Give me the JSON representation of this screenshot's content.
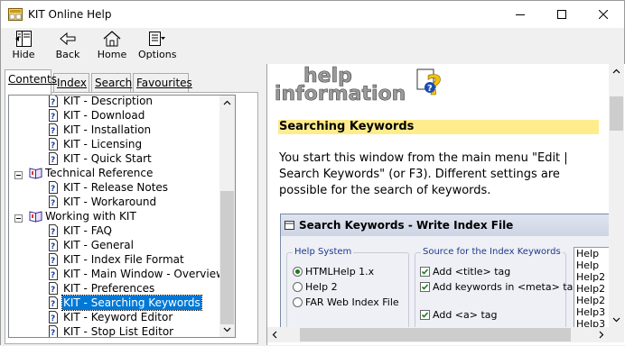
{
  "window": {
    "title": "KIT Online Help"
  },
  "toolbar": {
    "hide": "Hide",
    "back": "Back",
    "home": "Home",
    "options": "Options"
  },
  "tabs": [
    {
      "label": "Contents"
    },
    {
      "label": "Index"
    },
    {
      "label": "Search"
    },
    {
      "label": "Favourites"
    }
  ],
  "tree": [
    {
      "label": "KIT - Description",
      "type": "page",
      "level": 2
    },
    {
      "label": "KIT - Download",
      "type": "page",
      "level": 2
    },
    {
      "label": "KIT - Installation",
      "type": "page",
      "level": 2
    },
    {
      "label": "KIT - Licensing",
      "type": "page",
      "level": 2
    },
    {
      "label": "KIT - Quick Start",
      "type": "page",
      "level": 2
    },
    {
      "label": "Technical Reference",
      "type": "book",
      "level": 1
    },
    {
      "label": "KIT - Release Notes",
      "type": "page",
      "level": 2
    },
    {
      "label": "KIT - Workaround",
      "type": "page",
      "level": 2
    },
    {
      "label": "Working with KIT",
      "type": "book",
      "level": 1
    },
    {
      "label": "KIT - FAQ",
      "type": "page",
      "level": 2
    },
    {
      "label": "KIT - General",
      "type": "page",
      "level": 2
    },
    {
      "label": "KIT - Index File Format",
      "type": "page",
      "level": 2
    },
    {
      "label": "KIT - Main Window - Overview",
      "type": "page",
      "level": 2
    },
    {
      "label": "KIT - Preferences",
      "type": "page",
      "level": 2
    },
    {
      "label": "KIT - Searching Keywords",
      "type": "page",
      "level": 2,
      "selected": true
    },
    {
      "label": "KIT - Keyword Editor",
      "type": "page",
      "level": 2
    },
    {
      "label": "KIT - Stop List Editor",
      "type": "page",
      "level": 2
    }
  ],
  "content": {
    "banner_text": "help information",
    "heading": "Searching Keywords",
    "paragraph": "You start this window from the main menu \"Edit | Search Keywords\" (or F3). Different settings are possible for the search of keywords.",
    "dialog": {
      "title": "Search Keywords - Write Index File",
      "help_system_label": "Help System",
      "help_options": [
        {
          "label": "HTMLHelp 1.x",
          "checked": true
        },
        {
          "label": "Help 2",
          "checked": false
        },
        {
          "label": "FAR Web Index File",
          "checked": false
        }
      ],
      "source_label": "Source for the Index Keywords",
      "source_options": [
        {
          "label": "Add <title> tag",
          "checked": true
        },
        {
          "label": "Add keywords in <meta> tag",
          "checked": true
        },
        {
          "label": "Add <a> tag",
          "checked": true
        }
      ],
      "list_items": [
        "Help",
        "Help",
        "Help2",
        "Help2",
        "Help2",
        "Help3",
        "Help3"
      ]
    }
  },
  "colors": {
    "selection": "#0078d7",
    "heading_bg": "#ffec8c"
  }
}
